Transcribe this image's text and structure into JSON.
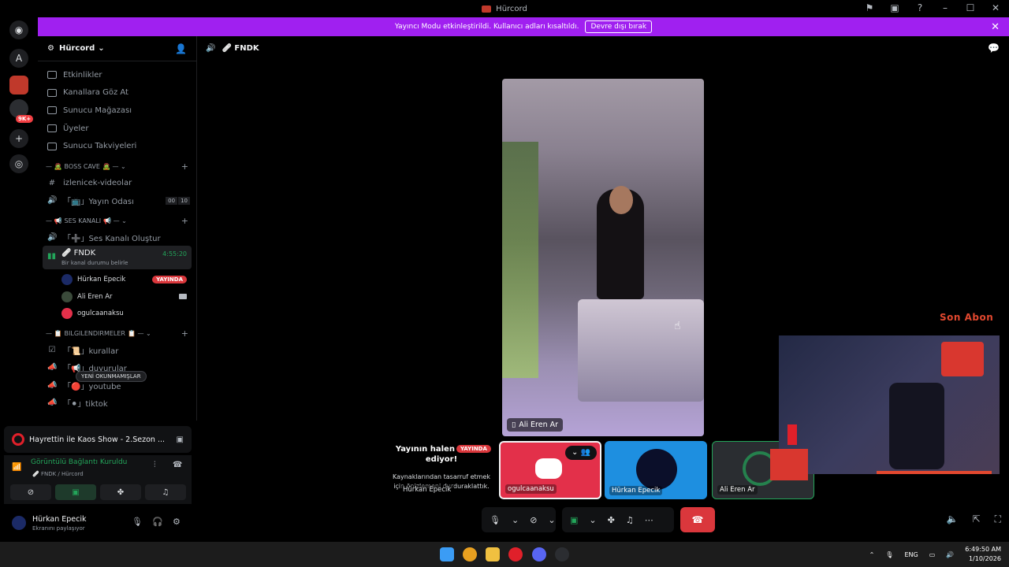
{
  "window": {
    "title": "Hürcord"
  },
  "banner": {
    "text": "Yayıncı Modu etkinleştirildi. Kullanıcı adları kısaltıldı.",
    "button": "Devre dışı bırak"
  },
  "rail": {
    "letter_server": "A",
    "mention_badge": "9K+"
  },
  "server": {
    "name": "Hürcord"
  },
  "menu": [
    {
      "label": "Etkinlikler",
      "icon": "calendar-icon"
    },
    {
      "label": "Kanallara Göz At",
      "icon": "browse-icon"
    },
    {
      "label": "Sunucu Mağazası",
      "icon": "shop-icon"
    },
    {
      "label": "Üyeler",
      "icon": "members-icon"
    },
    {
      "label": "Sunucu Takviyeleri",
      "icon": "boost-icon"
    }
  ],
  "categories": {
    "boss": "BOSS CAVE",
    "voice": "SES KANALI",
    "info": "BILGILENDIRMELER"
  },
  "channels": {
    "boss": [
      {
        "label": "izlenicek-videolar",
        "icon": "#"
      },
      {
        "label": "「📺」Yayın Odası",
        "icon": "🔊",
        "counts": [
          "00",
          "10"
        ]
      }
    ],
    "voice_create": "「➕」Ses Kanalı Oluştur",
    "active": {
      "name": "🩹 FNDK",
      "status": "Bir kanal durumu belirle",
      "time": "4:55:20"
    },
    "voice_users": [
      {
        "name": "Hürkan Epecik",
        "live": "YAYINDA"
      },
      {
        "name": "Ali Eren Ar"
      },
      {
        "name": "ogulcaanaksu"
      }
    ],
    "info": [
      {
        "label": "「📜」kurallar"
      },
      {
        "label": "「📢」duyurular"
      },
      {
        "label": "「🔴」youtube"
      },
      {
        "label": "「⚫」tiktok"
      }
    ],
    "unread_pill": "YENİ OKUNMAMIŞLAR"
  },
  "activity": {
    "title": "Hayrettin ile Kaos Show - 2.Sezon ..."
  },
  "voice_panel": {
    "status": "Görüntülü Bağlantı Kuruldu",
    "location": "🩹 FNDK / Hürcord"
  },
  "user": {
    "name": "Hürkan Epecik",
    "status": "Ekranını paylaşıyor"
  },
  "stage": {
    "channel": "🩹 FNDK",
    "main_video_label": "Ali Eren Ar",
    "stream_title": "Yayının halen devam ediyor!",
    "stream_desc": "Kaynaklarından tasarruf etmek için önizlemeni durduraklattık.",
    "stream_live": "YAYINDA",
    "stream_user": "Hürkan Epecik",
    "tiles": [
      "ogulcaanaksu",
      "Hürkan Epecik",
      "Ali Eren Ar"
    ],
    "overlay_text": "Son Abon"
  },
  "taskbar": {
    "lang": "ENG",
    "time": "6:49:50 AM",
    "date": "1/10/2026"
  }
}
